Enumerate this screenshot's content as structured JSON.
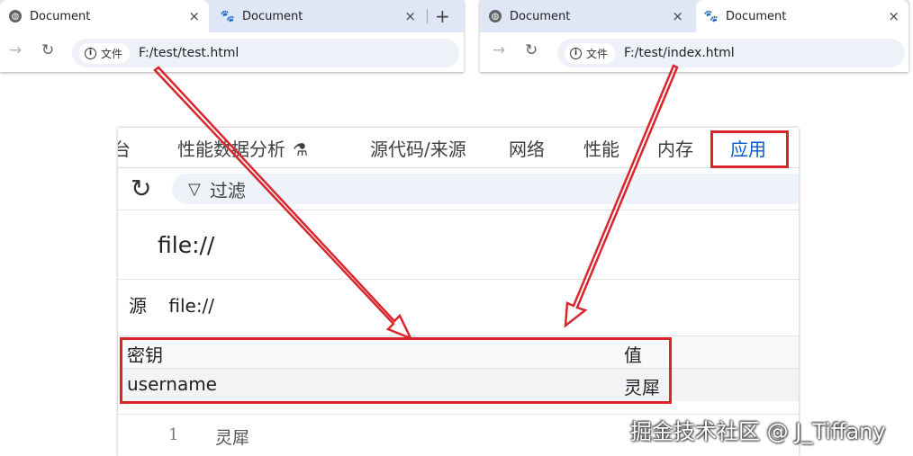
{
  "left_browser": {
    "tabs": [
      {
        "title": "Document",
        "icon": "globe-icon",
        "active": true
      },
      {
        "title": "Document",
        "icon": "baidu-paw-icon",
        "active": false
      }
    ],
    "new_tab": "+",
    "close": "×",
    "secure_chip": "文件",
    "url": "F:/test/test.html"
  },
  "right_browser": {
    "tabs": [
      {
        "title": "Document",
        "icon": "globe-icon",
        "active": false
      },
      {
        "title": "Document",
        "icon": "baidu-paw-icon",
        "active": true
      }
    ],
    "close": "×",
    "secure_chip": "文件",
    "url": "F:/test/index.html"
  },
  "devtools": {
    "tabs": [
      "台",
      "性能数据分析",
      "源代码/来源",
      "网络",
      "性能",
      "内存",
      "应用"
    ],
    "active_tab": "应用",
    "filter_placeholder": "过滤",
    "origin_title": "file://",
    "source_label": "源",
    "source_value": "file://",
    "table": {
      "headers": {
        "key": "密钥",
        "value": "值"
      },
      "rows": [
        {
          "key": "username",
          "value": "灵犀"
        }
      ]
    },
    "preview": {
      "line": "1",
      "value": "灵犀"
    }
  },
  "watermark": "掘金技术社区 @ J_Tiffany",
  "colors": {
    "annotation_red": "#d9262e",
    "active_tab_blue": "#0b57d0",
    "tabstrip": "#dfe7f6"
  }
}
